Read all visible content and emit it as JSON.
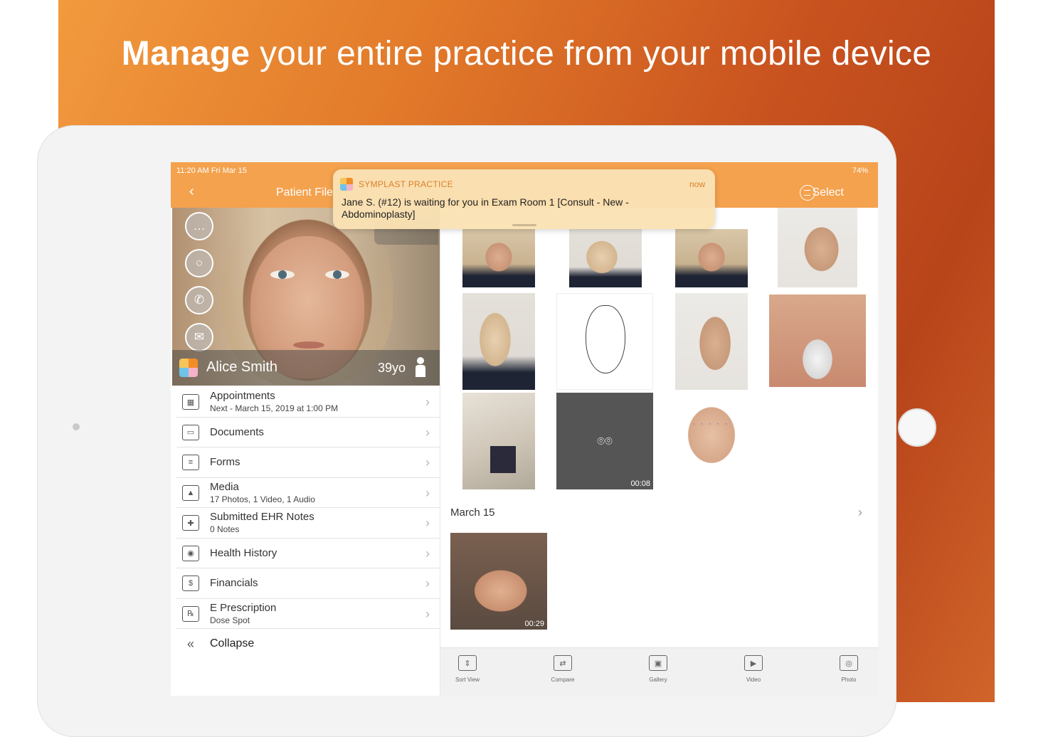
{
  "headline": {
    "bold": "Manage",
    "rest": " your entire practice from your mobile device"
  },
  "status": {
    "time": "11:20 AM   Fri Mar 15",
    "battery": "74%"
  },
  "nav": {
    "back": "‹",
    "title": "Patient File",
    "select": "Select"
  },
  "patient": {
    "name": "Alice Smith",
    "age": "39yo"
  },
  "actions": [
    {
      "name": "chat-icon",
      "glyph": "…"
    },
    {
      "name": "message-icon",
      "glyph": "○"
    },
    {
      "name": "phone-icon",
      "glyph": "✆"
    },
    {
      "name": "mail-icon",
      "glyph": "✉"
    }
  ],
  "menu": [
    {
      "label": "Appointments",
      "sub": "Next - March 15, 2019 at 1:00 PM",
      "icon": "calendar-icon",
      "glyph": "▦"
    },
    {
      "label": "Documents",
      "sub": "",
      "icon": "inbox-icon",
      "glyph": "▭"
    },
    {
      "label": "Forms",
      "sub": "",
      "icon": "form-icon",
      "glyph": "≡"
    },
    {
      "label": "Media",
      "sub": "17 Photos, 1 Video, 1 Audio",
      "icon": "image-icon",
      "glyph": "▲"
    },
    {
      "label": "Submitted EHR Notes",
      "sub": "0 Notes",
      "icon": "clipboard-icon",
      "glyph": "✚"
    },
    {
      "label": "Health History",
      "sub": "",
      "icon": "history-icon",
      "glyph": "◉"
    },
    {
      "label": "Financials",
      "sub": "",
      "icon": "financials-icon",
      "glyph": "$"
    },
    {
      "label": "E Prescription",
      "sub": "Dose Spot",
      "icon": "rx-icon",
      "glyph": "℞"
    },
    {
      "label": "Collapse",
      "sub": "",
      "icon": "collapse-icon",
      "glyph": "«"
    }
  ],
  "gallery": {
    "video_duration": "00:08",
    "section": "March 15",
    "section_video_duration": "00:29"
  },
  "toolbar": [
    {
      "label": "Sort View",
      "icon": "sort-icon",
      "glyph": "⇕"
    },
    {
      "label": "Compare",
      "icon": "compare-icon",
      "glyph": "⇄"
    },
    {
      "label": "Gallery",
      "icon": "gallery-icon",
      "glyph": "▣"
    },
    {
      "label": "Video",
      "icon": "video-icon",
      "glyph": "▶"
    },
    {
      "label": "Photo",
      "icon": "camera-icon",
      "glyph": "◎"
    }
  ],
  "notification": {
    "app": "SYMPLAST PRACTICE",
    "time": "now",
    "body": "Jane S. (#12) is waiting for you in Exam Room 1 [Consult - New - Abdominoplasty]"
  }
}
